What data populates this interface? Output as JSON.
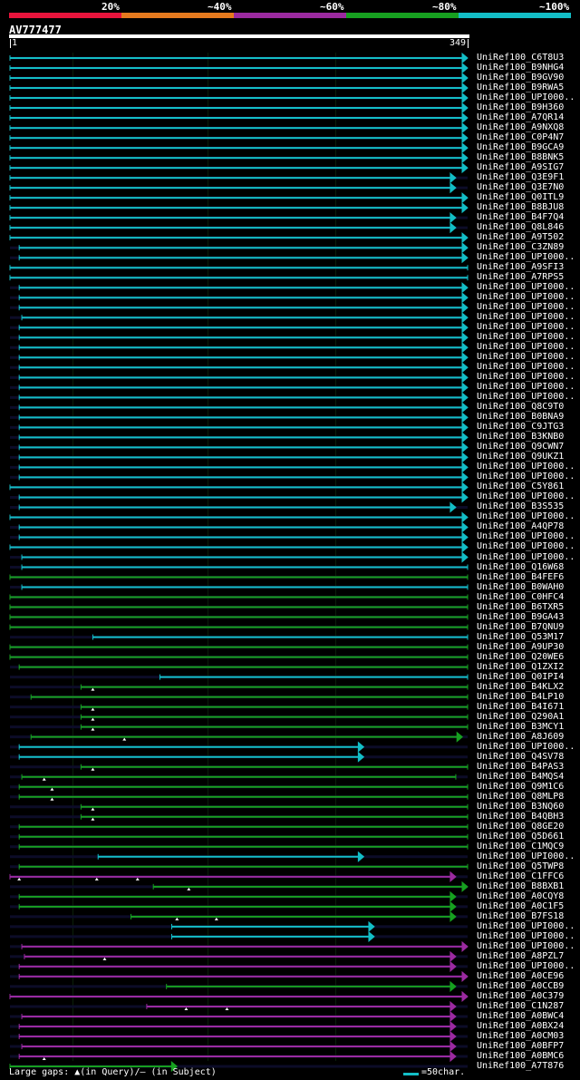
{
  "legend": [
    {
      "label": "20%",
      "color": "#e8143c"
    },
    {
      "label": "~40%",
      "color": "#e67a1e"
    },
    {
      "label": "~60%",
      "color": "#9b2aa0"
    },
    {
      "label": "~80%",
      "color": "#17a020"
    },
    {
      "label": "~100%",
      "color": "#13bec6"
    }
  ],
  "query": {
    "name": "AV777477",
    "start": "1",
    "end": "349"
  },
  "footer": {
    "legend_text": "Large gaps: ▲(in Query)/– (in Subject)",
    "scale_text": "=50char."
  },
  "hits": [
    {
      "name": "UniRef100_C6T8U3",
      "c": 4,
      "s": 1,
      "e": 349,
      "a": 1
    },
    {
      "name": "UniRef100_B9NHG4",
      "c": 4,
      "s": 1,
      "e": 349,
      "a": 1
    },
    {
      "name": "UniRef100_B9GV90",
      "c": 4,
      "s": 1,
      "e": 349,
      "a": 1
    },
    {
      "name": "UniRef100_B9RWA5",
      "c": 4,
      "s": 1,
      "e": 349,
      "a": 1
    },
    {
      "name": "UniRef100_UPI000..",
      "c": 4,
      "s": 1,
      "e": 349,
      "a": 1
    },
    {
      "name": "UniRef100_B9H360",
      "c": 4,
      "s": 1,
      "e": 349,
      "a": 1
    },
    {
      "name": "UniRef100_A7QR14",
      "c": 4,
      "s": 1,
      "e": 349,
      "a": 1
    },
    {
      "name": "UniRef100_A9NXQ8",
      "c": 4,
      "s": 1,
      "e": 349,
      "a": 1
    },
    {
      "name": "UniRef100_C0P4N7",
      "c": 4,
      "s": 1,
      "e": 349,
      "a": 1
    },
    {
      "name": "UniRef100_B9GCA9",
      "c": 4,
      "s": 1,
      "e": 349,
      "a": 1
    },
    {
      "name": "UniRef100_B8BNK5",
      "c": 4,
      "s": 1,
      "e": 349,
      "a": 1
    },
    {
      "name": "UniRef100_A9SIG7",
      "c": 4,
      "s": 1,
      "e": 349,
      "a": 1
    },
    {
      "name": "UniRef100_Q3E9F1",
      "c": 4,
      "s": 1,
      "e": 340,
      "a": 1
    },
    {
      "name": "UniRef100_Q3E7N0",
      "c": 4,
      "s": 1,
      "e": 340,
      "a": 1
    },
    {
      "name": "UniRef100_Q0ITL9",
      "c": 4,
      "s": 1,
      "e": 349,
      "a": 1
    },
    {
      "name": "UniRef100_B8BJU8",
      "c": 4,
      "s": 1,
      "e": 349,
      "a": 1
    },
    {
      "name": "UniRef100_B4F7Q4",
      "c": 4,
      "s": 1,
      "e": 340,
      "a": 1
    },
    {
      "name": "UniRef100_Q8L846",
      "c": 4,
      "s": 1,
      "e": 340,
      "a": 1
    },
    {
      "name": "UniRef100_A9T502",
      "c": 4,
      "s": 1,
      "e": 349,
      "a": 1
    },
    {
      "name": "UniRef100_C3ZN89",
      "c": 4,
      "s": 8,
      "e": 349,
      "a": 1
    },
    {
      "name": "UniRef100_UPI000..",
      "c": 4,
      "s": 8,
      "e": 349,
      "a": 1
    },
    {
      "name": "UniRef100_A9SFI3",
      "c": 4,
      "s": 1,
      "e": 349,
      "a": 0
    },
    {
      "name": "UniRef100_A7RPS5",
      "c": 4,
      "s": 1,
      "e": 349,
      "a": 0
    },
    {
      "name": "UniRef100_UPI000..",
      "c": 4,
      "s": 8,
      "e": 349,
      "a": 1
    },
    {
      "name": "UniRef100_UPI000..",
      "c": 4,
      "s": 8,
      "e": 349,
      "a": 1
    },
    {
      "name": "UniRef100_UPI000..",
      "c": 4,
      "s": 8,
      "e": 349,
      "a": 1
    },
    {
      "name": "UniRef100_UPI000..",
      "c": 4,
      "s": 10,
      "e": 349,
      "a": 1
    },
    {
      "name": "UniRef100_UPI000..",
      "c": 4,
      "s": 8,
      "e": 349,
      "a": 1
    },
    {
      "name": "UniRef100_UPI000..",
      "c": 4,
      "s": 8,
      "e": 349,
      "a": 1
    },
    {
      "name": "UniRef100_UPI000..",
      "c": 4,
      "s": 8,
      "e": 349,
      "a": 1
    },
    {
      "name": "UniRef100_UPI000..",
      "c": 4,
      "s": 8,
      "e": 349,
      "a": 1
    },
    {
      "name": "UniRef100_UPI000..",
      "c": 4,
      "s": 8,
      "e": 349,
      "a": 1
    },
    {
      "name": "UniRef100_UPI000..",
      "c": 4,
      "s": 8,
      "e": 349,
      "a": 1
    },
    {
      "name": "UniRef100_UPI000..",
      "c": 4,
      "s": 8,
      "e": 349,
      "a": 1
    },
    {
      "name": "UniRef100_UPI000..",
      "c": 4,
      "s": 8,
      "e": 349,
      "a": 1
    },
    {
      "name": "UniRef100_Q8C9T0",
      "c": 4,
      "s": 8,
      "e": 349,
      "a": 1
    },
    {
      "name": "UniRef100_B0BNA9",
      "c": 4,
      "s": 8,
      "e": 349,
      "a": 1
    },
    {
      "name": "UniRef100_C9JTG3",
      "c": 4,
      "s": 8,
      "e": 349,
      "a": 1
    },
    {
      "name": "UniRef100_B3KNB0",
      "c": 4,
      "s": 8,
      "e": 349,
      "a": 1
    },
    {
      "name": "UniRef100_Q9CWN7",
      "c": 4,
      "s": 8,
      "e": 349,
      "a": 1
    },
    {
      "name": "UniRef100_Q9UKZ1",
      "c": 4,
      "s": 8,
      "e": 349,
      "a": 1
    },
    {
      "name": "UniRef100_UPI000..",
      "c": 4,
      "s": 8,
      "e": 349,
      "a": 1
    },
    {
      "name": "UniRef100_UPI000..",
      "c": 4,
      "s": 8,
      "e": 349,
      "a": 1
    },
    {
      "name": "UniRef100_C5Y861",
      "c": 4,
      "s": 1,
      "e": 349,
      "a": 1
    },
    {
      "name": "UniRef100_UPI000..",
      "c": 4,
      "s": 8,
      "e": 349,
      "a": 1
    },
    {
      "name": "UniRef100_B3S535",
      "c": 4,
      "s": 8,
      "e": 340,
      "a": 1
    },
    {
      "name": "UniRef100_UPI000..",
      "c": 4,
      "s": 1,
      "e": 349,
      "a": 1
    },
    {
      "name": "UniRef100_A4QP78",
      "c": 4,
      "s": 8,
      "e": 349,
      "a": 1
    },
    {
      "name": "UniRef100_UPI000..",
      "c": 4,
      "s": 8,
      "e": 349,
      "a": 1
    },
    {
      "name": "UniRef100_UPI000..",
      "c": 4,
      "s": 1,
      "e": 349,
      "a": 1
    },
    {
      "name": "UniRef100_UPI000..",
      "c": 4,
      "s": 10,
      "e": 349,
      "a": 1
    },
    {
      "name": "UniRef100_Q16W68",
      "c": 4,
      "s": 10,
      "e": 349,
      "a": 0
    },
    {
      "name": "UniRef100_B4FEF6",
      "c": 3,
      "s": 1,
      "e": 349,
      "a": 0
    },
    {
      "name": "UniRef100_B0WAH0",
      "c": 4,
      "s": 10,
      "e": 349,
      "a": 0
    },
    {
      "name": "UniRef100_C0HFC4",
      "c": 3,
      "s": 1,
      "e": 349,
      "a": 0
    },
    {
      "name": "UniRef100_B6TXR5",
      "c": 3,
      "s": 1,
      "e": 349,
      "a": 0
    },
    {
      "name": "UniRef100_B9GA43",
      "c": 3,
      "s": 1,
      "e": 349,
      "a": 0
    },
    {
      "name": "UniRef100_B7QNU9",
      "c": 3,
      "s": 1,
      "e": 349,
      "a": 0
    },
    {
      "name": "UniRef100_Q53M17",
      "c": 4,
      "s": 64,
      "e": 349,
      "a": 0
    },
    {
      "name": "UniRef100_A9UP30",
      "c": 3,
      "s": 1,
      "e": 349,
      "a": 0
    },
    {
      "name": "UniRef100_Q20WE6",
      "c": 3,
      "s": 1,
      "e": 349,
      "a": 0
    },
    {
      "name": "UniRef100_Q1ZXI2",
      "c": 3,
      "s": 8,
      "e": 349,
      "a": 0
    },
    {
      "name": "UniRef100_Q0IPI4",
      "c": 4,
      "s": 115,
      "e": 349,
      "a": 0
    },
    {
      "name": "UniRef100_B4KLX2",
      "c": 3,
      "s": 55,
      "e": 349,
      "a": 0,
      "m": [
        64
      ]
    },
    {
      "name": "UniRef100_B4LP10",
      "c": 3,
      "s": 17,
      "e": 349,
      "a": 0
    },
    {
      "name": "UniRef100_B4I671",
      "c": 3,
      "s": 55,
      "e": 349,
      "a": 0,
      "m": [
        64
      ]
    },
    {
      "name": "UniRef100_Q290A1",
      "c": 3,
      "s": 55,
      "e": 349,
      "a": 0,
      "m": [
        64
      ]
    },
    {
      "name": "UniRef100_B3MCY1",
      "c": 3,
      "s": 55,
      "e": 349,
      "a": 0,
      "m": [
        64
      ]
    },
    {
      "name": "UniRef100_A8J609",
      "c": 3,
      "s": 17,
      "e": 345,
      "a": 1,
      "m": [
        88
      ]
    },
    {
      "name": "UniRef100_UPI000..",
      "c": 4,
      "s": 8,
      "e": 270,
      "a": 1
    },
    {
      "name": "UniRef100_Q4SV78",
      "c": 4,
      "s": 8,
      "e": 270,
      "a": 1
    },
    {
      "name": "UniRef100_B4PAS3",
      "c": 3,
      "s": 55,
      "e": 349,
      "a": 0,
      "m": [
        64
      ]
    },
    {
      "name": "UniRef100_B4MQS4",
      "c": 3,
      "s": 10,
      "e": 340,
      "a": 0,
      "m": [
        27
      ]
    },
    {
      "name": "UniRef100_Q9M1C6",
      "c": 3,
      "s": 8,
      "e": 349,
      "a": 0,
      "m": [
        33
      ]
    },
    {
      "name": "UniRef100_Q8MLP8",
      "c": 3,
      "s": 8,
      "e": 349,
      "a": 0,
      "m": [
        33
      ]
    },
    {
      "name": "UniRef100_B3NQ60",
      "c": 3,
      "s": 55,
      "e": 349,
      "a": 0,
      "m": [
        64
      ]
    },
    {
      "name": "UniRef100_B4QBH3",
      "c": 3,
      "s": 55,
      "e": 349,
      "a": 0,
      "m": [
        64
      ]
    },
    {
      "name": "UniRef100_Q8GE20",
      "c": 3,
      "s": 8,
      "e": 349,
      "a": 0
    },
    {
      "name": "UniRef100_Q5D661",
      "c": 3,
      "s": 8,
      "e": 349,
      "a": 0
    },
    {
      "name": "UniRef100_C1MQC9",
      "c": 3,
      "s": 8,
      "e": 349,
      "a": 0
    },
    {
      "name": "UniRef100_UPI000..",
      "c": 4,
      "s": 68,
      "e": 270,
      "a": 1
    },
    {
      "name": "UniRef100_Q5TWP8",
      "c": 3,
      "s": 8,
      "e": 349,
      "a": 0
    },
    {
      "name": "UniRef100_C1FFC6",
      "c": 2,
      "s": 1,
      "e": 340,
      "a": 1,
      "m": [
        8,
        67,
        98
      ]
    },
    {
      "name": "UniRef100_B8BXB1",
      "c": 3,
      "s": 110,
      "e": 349,
      "a": 1,
      "m": [
        137
      ]
    },
    {
      "name": "UniRef100_A0CQY8",
      "c": 3,
      "s": 8,
      "e": 340,
      "a": 1
    },
    {
      "name": "UniRef100_A0C1F5",
      "c": 3,
      "s": 8,
      "e": 340,
      "a": 1
    },
    {
      "name": "UniRef100_B7FS18",
      "c": 3,
      "s": 93,
      "e": 340,
      "a": 1,
      "m": [
        128,
        158
      ]
    },
    {
      "name": "UniRef100_UPI000..",
      "c": 4,
      "s": 124,
      "e": 278,
      "a": 1
    },
    {
      "name": "UniRef100_UPI000..",
      "c": 4,
      "s": 124,
      "e": 278,
      "a": 1
    },
    {
      "name": "UniRef100_UPI000..",
      "c": 2,
      "s": 10,
      "e": 349,
      "a": 1
    },
    {
      "name": "UniRef100_A8PZL7",
      "c": 2,
      "s": 12,
      "e": 340,
      "a": 1,
      "m": [
        73
      ]
    },
    {
      "name": "UniRef100_UPI000..",
      "c": 2,
      "s": 8,
      "e": 340,
      "a": 1
    },
    {
      "name": "UniRef100_A0CE96",
      "c": 2,
      "s": 8,
      "e": 349,
      "a": 1
    },
    {
      "name": "UniRef100_A0CCB9",
      "c": 3,
      "s": 120,
      "e": 340,
      "a": 1
    },
    {
      "name": "UniRef100_A0C379",
      "c": 2,
      "s": 1,
      "e": 349,
      "a": 1
    },
    {
      "name": "UniRef100_C1N287",
      "c": 2,
      "s": 105,
      "e": 340,
      "a": 1,
      "m": [
        135,
        166
      ]
    },
    {
      "name": "UniRef100_A0BWC4",
      "c": 2,
      "s": 10,
      "e": 340,
      "a": 1
    },
    {
      "name": "UniRef100_A0BX24",
      "c": 2,
      "s": 8,
      "e": 340,
      "a": 1
    },
    {
      "name": "UniRef100_A0CM03",
      "c": 2,
      "s": 8,
      "e": 340,
      "a": 1
    },
    {
      "name": "UniRef100_A0BFP7",
      "c": 2,
      "s": 10,
      "e": 340,
      "a": 1
    },
    {
      "name": "UniRef100_A0BMC6",
      "c": 2,
      "s": 8,
      "e": 340,
      "a": 1,
      "m": [
        27
      ]
    },
    {
      "name": "UniRef100_A7T876",
      "c": 3,
      "s": 1,
      "e": 128,
      "a": 1
    }
  ]
}
